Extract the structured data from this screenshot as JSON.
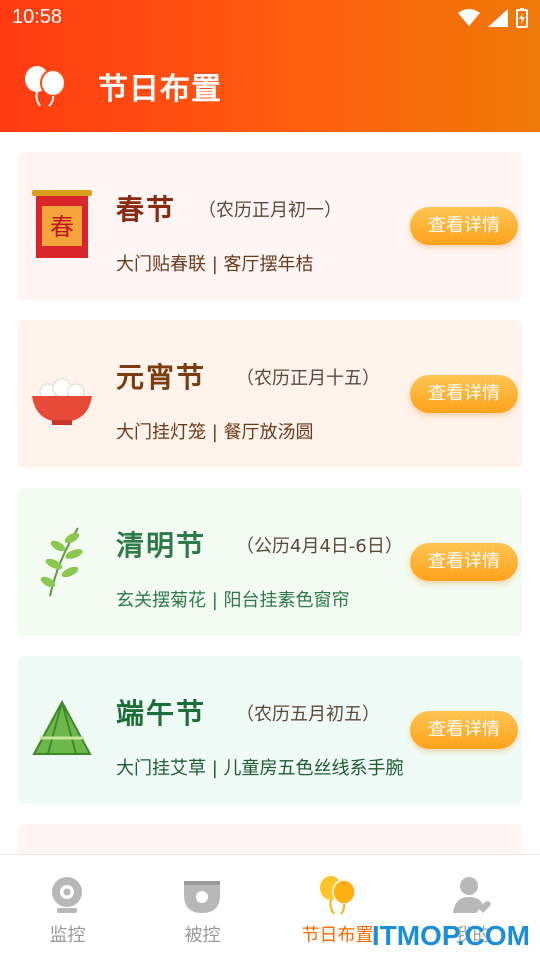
{
  "status": {
    "time": "10:58"
  },
  "header": {
    "title": "节日布置",
    "icon": "balloon-icon"
  },
  "festivals": [
    {
      "name": "春节",
      "date": "（农历正月初一）",
      "desc": "大门贴春联 | 客厅摆年桔",
      "button": "查看详情",
      "icon": "spring-scroll-icon",
      "name_color": "#8b2a12",
      "desc_color": "#6b3a1a",
      "bg": "#fff5f5"
    },
    {
      "name": "元宵节",
      "date": "（农历正月十五）",
      "desc": "大门挂灯笼 | 餐厅放汤圆",
      "button": "查看详情",
      "icon": "tangyuan-bowl-icon",
      "name_color": "#7a3c10",
      "desc_color": "#6b3a1a",
      "bg": "#fff3ec"
    },
    {
      "name": "清明节",
      "date": "（公历4月4日-6日）",
      "desc": "玄关摆菊花 | 阳台挂素色窗帘",
      "button": "查看详情",
      "icon": "willow-leaf-icon",
      "name_color": "#2e7a4a",
      "desc_color": "#2e7a4a",
      "bg": "#f3fbf3"
    },
    {
      "name": "端午节",
      "date": "（农历五月初五）",
      "desc": "大门挂艾草 | 儿童房五色丝线系手腕",
      "button": "查看详情",
      "icon": "zongzi-icon",
      "name_color": "#1e6e3a",
      "desc_color": "#1e5a30",
      "bg": "#f0fbf8"
    }
  ],
  "tabs": [
    {
      "label": "监控",
      "icon": "camera-icon"
    },
    {
      "label": "被控",
      "icon": "device-icon"
    },
    {
      "label": "节日布置",
      "icon": "balloon-icon"
    },
    {
      "label": "我的",
      "icon": "user-heart-icon"
    }
  ],
  "watermark": "ITMOP.COM"
}
